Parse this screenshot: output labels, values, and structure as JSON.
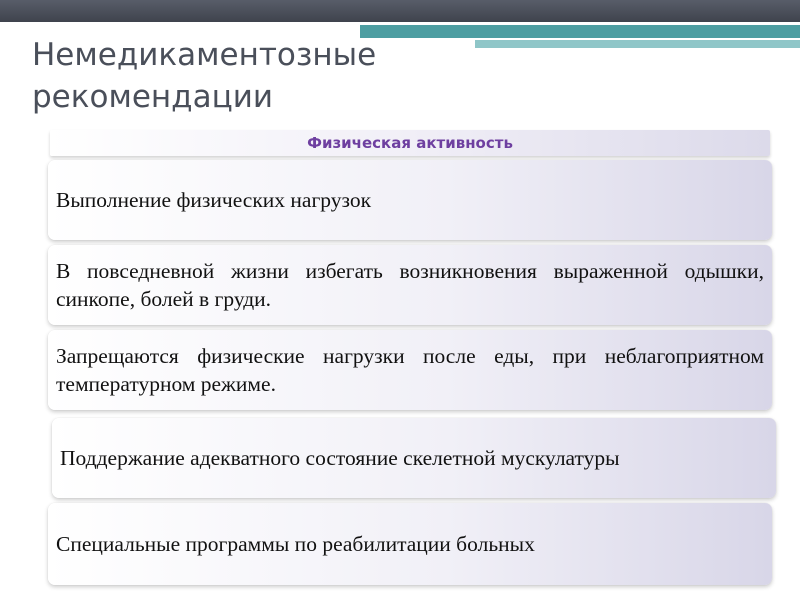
{
  "slide": {
    "title": "Немедикаментозные рекомендации",
    "header": "Физическая активность",
    "items": [
      "Выполнение физических нагрузок",
      "В повседневной жизни избегать возникновения выраженной одышки, синкопе, болей в груди.",
      "Запрещаются физические нагрузки после еды, при неблагоприятном температурном режиме.",
      "Поддержание адекватного состояние скелетной мускулатуры",
      "Специальные программы по реабилитации больных"
    ]
  },
  "colors": {
    "header_text": "#6e3fa0",
    "title_text": "#4a4f5a",
    "accent_teal": "#4d9ea2",
    "top_bar": "#4a4e58"
  }
}
